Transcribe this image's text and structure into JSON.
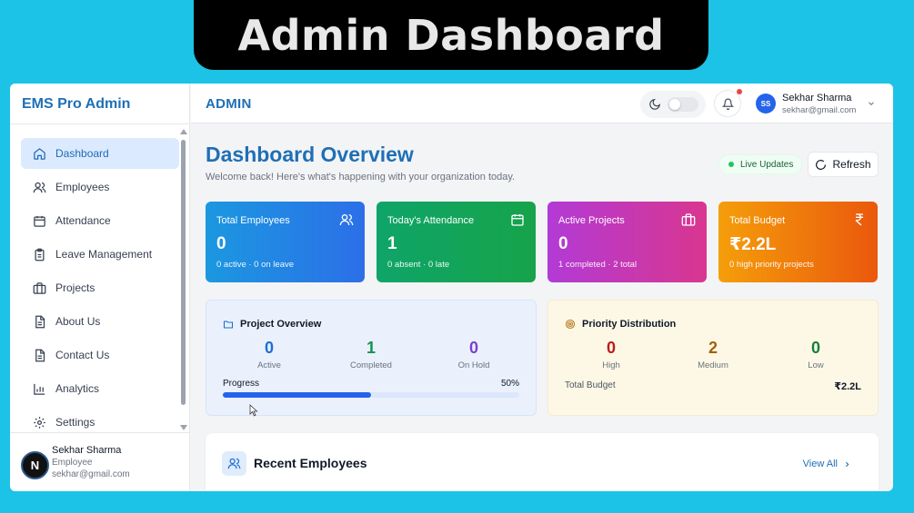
{
  "banner": {
    "title": "Admin Dashboard"
  },
  "sidebar": {
    "brand": "EMS Pro Admin",
    "items": [
      {
        "label": "Dashboard",
        "icon": "home-icon",
        "active": true
      },
      {
        "label": "Employees",
        "icon": "users-icon"
      },
      {
        "label": "Attendance",
        "icon": "calendar-icon"
      },
      {
        "label": "Leave Management",
        "icon": "clipboard-icon"
      },
      {
        "label": "Projects",
        "icon": "briefcase-icon"
      },
      {
        "label": "About Us",
        "icon": "document-icon"
      },
      {
        "label": "Contact Us",
        "icon": "document-icon"
      },
      {
        "label": "Analytics",
        "icon": "bar-chart-icon"
      },
      {
        "label": "Settings",
        "icon": "gear-icon"
      }
    ],
    "user": {
      "initial": "N",
      "name": "Sekhar Sharma",
      "role": "Employee",
      "email": "sekhar@gmail.com"
    }
  },
  "header": {
    "title": "ADMIN",
    "user": {
      "initials": "SS",
      "name": "Sekhar Sharma",
      "email": "sekhar@gmail.com"
    }
  },
  "main": {
    "title": "Dashboard Overview",
    "subtitle": "Welcome back! Here's what's happening with your organization today.",
    "live_label": "Live Updates",
    "refresh_label": "Refresh",
    "stats": [
      {
        "label": "Total Employees",
        "value": "0",
        "sub": "0 active · 0 on leave",
        "icon": "users-icon"
      },
      {
        "label": "Today's Attendance",
        "value": "1",
        "sub": "0 absent · 0 late",
        "icon": "calendar-icon"
      },
      {
        "label": "Active Projects",
        "value": "0",
        "sub": "1 completed · 2 total",
        "icon": "briefcase-icon"
      },
      {
        "label": "Total Budget",
        "value": "₹2.2L",
        "sub": "0 high priority projects",
        "icon": "rupee-icon"
      }
    ],
    "project_overview": {
      "title": "Project Overview",
      "metrics": [
        {
          "value": "0",
          "label": "Active",
          "color": "#1d6fd1"
        },
        {
          "value": "1",
          "label": "Completed",
          "color": "#15924f"
        },
        {
          "value": "0",
          "label": "On Hold",
          "color": "#7e3fcf"
        }
      ],
      "progress_label": "Progress",
      "progress_text": "50%",
      "progress": 0.5
    },
    "priority": {
      "title": "Priority Distribution",
      "metrics": [
        {
          "value": "0",
          "label": "High",
          "color": "#b91c1c"
        },
        {
          "value": "2",
          "label": "Medium",
          "color": "#a16207"
        },
        {
          "value": "0",
          "label": "Low",
          "color": "#15803d"
        }
      ],
      "budget_label": "Total Budget",
      "budget_value": "₹2.2L"
    },
    "recent": {
      "title": "Recent Employees",
      "view_all": "View All"
    }
  },
  "colors": {
    "brand": "#1f6fb5",
    "accent": "#1cc3e6"
  }
}
